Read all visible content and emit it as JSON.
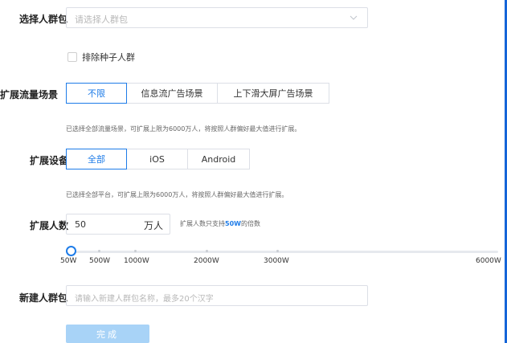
{
  "crowd_package": {
    "label": "选择人群包",
    "placeholder": "请选择人群包"
  },
  "exclude_seed": {
    "label": "排除种子人群",
    "checked": false
  },
  "traffic_scene": {
    "label": "扩展流量场景",
    "options": [
      "不限",
      "信息流广告场景",
      "上下滑大屏广告场景"
    ],
    "selected": "不限",
    "hint": "已选择全部流量场景，可扩展上限为6000万人，将按照人群偏好最大值进行扩展。"
  },
  "device": {
    "label": "扩展设备",
    "options": [
      "全部",
      "iOS",
      "Android"
    ],
    "selected": "全部",
    "hint": "已选择全部平台，可扩展上限为6000万人，将按照人群偏好最大值进行扩展。"
  },
  "expand_count": {
    "label": "扩展人数",
    "value": "50",
    "unit": "万人",
    "hint_prefix": "扩展人数只支持",
    "hint_bold": "50W",
    "hint_suffix": "的倍数"
  },
  "slider": {
    "min": 50,
    "max": 6000,
    "value": 50,
    "marks": [
      "50W",
      "500W",
      "1000W",
      "2000W",
      "3000W",
      "6000W"
    ]
  },
  "new_package": {
    "label": "新建人群包",
    "placeholder": "请输入新建人群包名称，最多20个汉字"
  },
  "submit": {
    "label": "完成"
  },
  "colors": {
    "accent": "#1e7ce8",
    "button_disabled": "#a8d3f7",
    "border": "#dcdfe6",
    "edge": "#1565d8"
  }
}
